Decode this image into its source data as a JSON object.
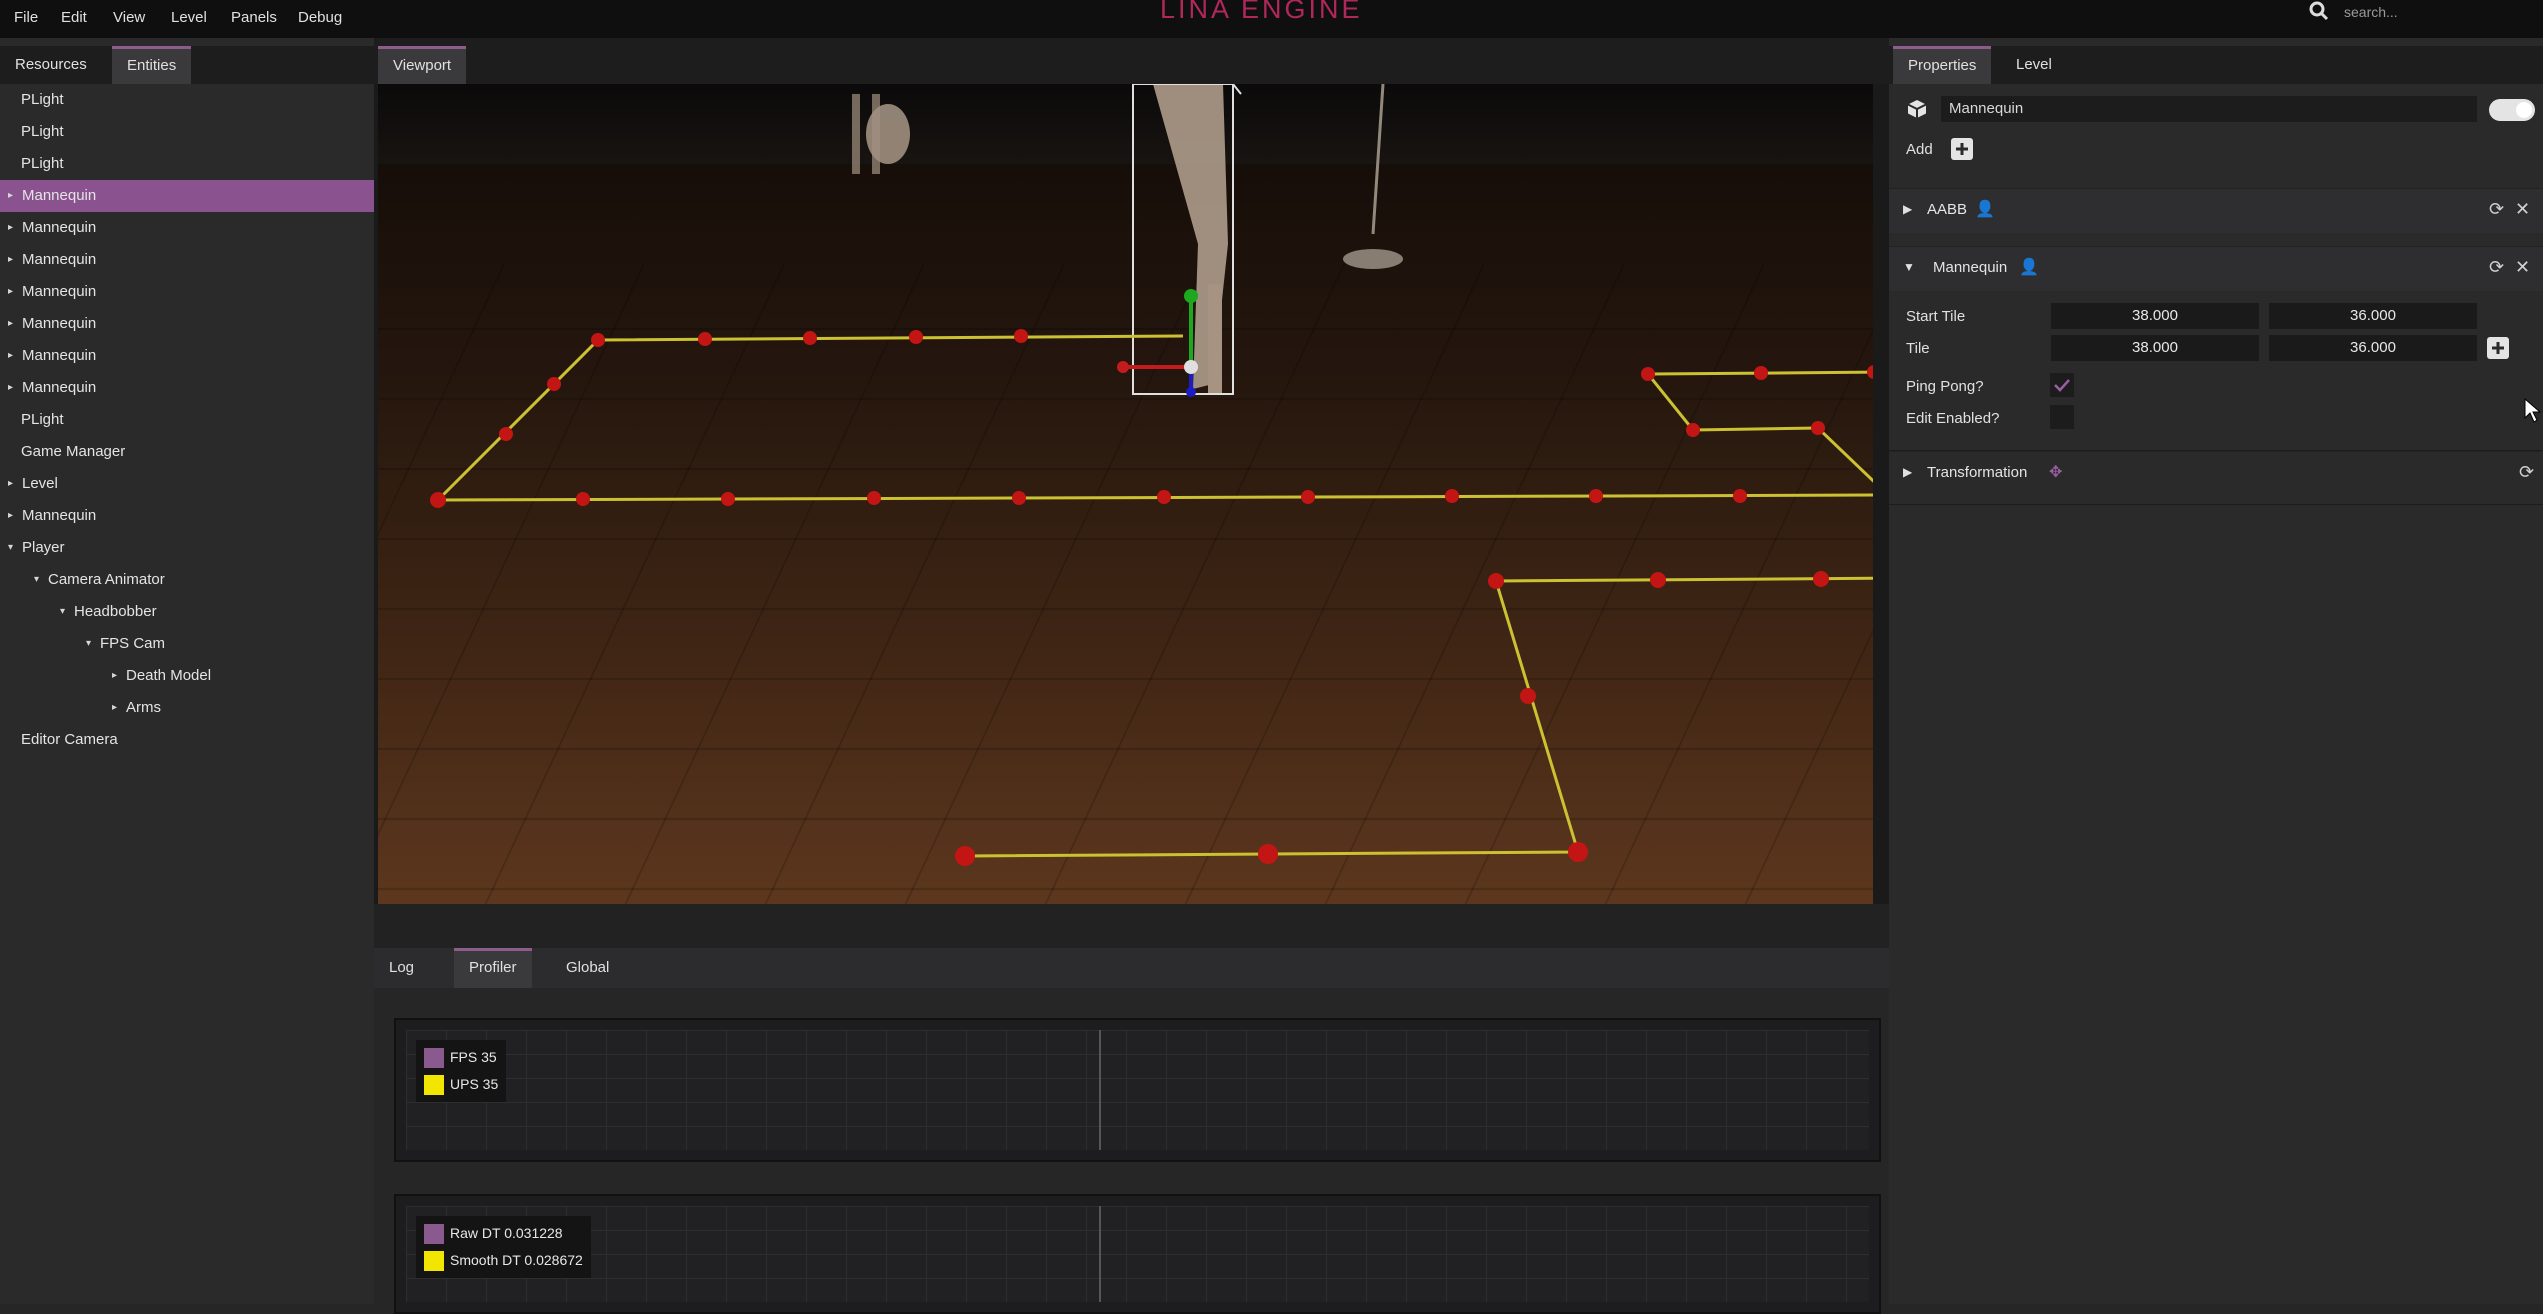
{
  "menu": [
    "File",
    "Edit",
    "View",
    "Level",
    "Panels",
    "Debug"
  ],
  "app_title": "LINA ENGINE",
  "search": {
    "placeholder": "search..."
  },
  "left_panel": {
    "tabs": [
      "Resources",
      "Entities"
    ],
    "active_tab": "Entities",
    "nodes": [
      {
        "label": "PLight",
        "depth": 0,
        "arrow": ""
      },
      {
        "label": "PLight",
        "depth": 0,
        "arrow": ""
      },
      {
        "label": "PLight",
        "depth": 0,
        "arrow": ""
      },
      {
        "label": "Mannequin",
        "depth": 0,
        "arrow": "▸",
        "selected": true
      },
      {
        "label": "Mannequin",
        "depth": 0,
        "arrow": "▸"
      },
      {
        "label": "Mannequin",
        "depth": 0,
        "arrow": "▸"
      },
      {
        "label": "Mannequin",
        "depth": 0,
        "arrow": "▸"
      },
      {
        "label": "Mannequin",
        "depth": 0,
        "arrow": "▸"
      },
      {
        "label": "Mannequin",
        "depth": 0,
        "arrow": "▸"
      },
      {
        "label": "Mannequin",
        "depth": 0,
        "arrow": "▸"
      },
      {
        "label": "PLight",
        "depth": 0,
        "arrow": ""
      },
      {
        "label": "Game Manager",
        "depth": 0,
        "arrow": ""
      },
      {
        "label": "Level",
        "depth": 0,
        "arrow": "▸"
      },
      {
        "label": "Mannequin",
        "depth": 0,
        "arrow": "▸"
      },
      {
        "label": "Player",
        "depth": 0,
        "arrow": "▾"
      },
      {
        "label": "Camera Animator",
        "depth": 1,
        "arrow": "▾"
      },
      {
        "label": "Headbobber",
        "depth": 2,
        "arrow": "▾"
      },
      {
        "label": "FPS Cam",
        "depth": 3,
        "arrow": "▾"
      },
      {
        "label": "Death Model",
        "depth": 4,
        "arrow": "▸"
      },
      {
        "label": "Arms",
        "depth": 4,
        "arrow": "▸"
      },
      {
        "label": "Editor Camera",
        "depth": 0,
        "arrow": ""
      }
    ]
  },
  "viewport": {
    "tab": "Viewport"
  },
  "bottom_panel": {
    "tabs": [
      "Log",
      "Profiler",
      "Global"
    ],
    "active_tab": "Profiler",
    "graph1": {
      "entries": [
        {
          "label": "FPS 35",
          "color": "#8a5a8e"
        },
        {
          "label": "UPS 35",
          "color": "#f2e600"
        }
      ]
    },
    "graph2": {
      "entries": [
        {
          "label": "Raw DT 0.031228",
          "color": "#8a5a8e"
        },
        {
          "label": "Smooth DT 0.028672",
          "color": "#f2e600"
        }
      ]
    }
  },
  "properties": {
    "tabs": [
      "Properties",
      "Level"
    ],
    "active_tab": "Properties",
    "entity_name": "Mannequin",
    "add_label": "Add",
    "sections": {
      "aabb": "AABB",
      "mannequin": "Mannequin",
      "transformation": "Transformation"
    },
    "fields": {
      "start_tile_label": "Start Tile",
      "start_tile_x": "38.000",
      "start_tile_y": "36.000",
      "tile_label": "Tile",
      "tile_x": "38.000",
      "tile_y": "36.000",
      "ping_pong_label": "Ping Pong?",
      "ping_pong_checked": true,
      "edit_enabled_label": "Edit Enabled?",
      "edit_enabled_checked": false
    }
  },
  "colors": {
    "accent": "#8a5390",
    "path_line": "#e8dc3a",
    "path_node": "#e01818"
  }
}
